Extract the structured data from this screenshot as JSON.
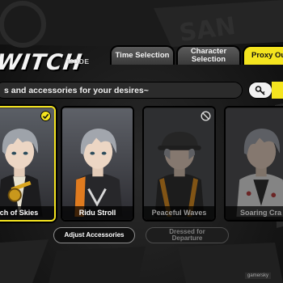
{
  "header": {
    "mode_title": "WITCH",
    "mode_suffix": "MODE"
  },
  "tabs": [
    {
      "label": "Time Selection",
      "active": false
    },
    {
      "label": "Character Selection",
      "active": false
    },
    {
      "label": "Proxy Ou",
      "active": true
    }
  ],
  "subtitle": "s and accessories for your desires~",
  "search_icon": "key-icon",
  "outfits": [
    {
      "name": "ch of Skies",
      "selected": true,
      "locked": false,
      "badge": "check-icon"
    },
    {
      "name": "Ridu Stroll",
      "selected": false,
      "locked": false,
      "badge": ""
    },
    {
      "name": "Peaceful Waves",
      "selected": false,
      "locked": true,
      "badge": "prohibited-icon"
    },
    {
      "name": "Soaring Cra",
      "selected": false,
      "locked": true,
      "badge": ""
    }
  ],
  "buttons": {
    "adjust": "Adjust Accessories",
    "dressed": "Dressed for Departure"
  },
  "watermark": "gamersky",
  "colors": {
    "accent_yellow": "#f4e41f",
    "tab_gray": "#4a4a4a",
    "background": "#151515"
  }
}
